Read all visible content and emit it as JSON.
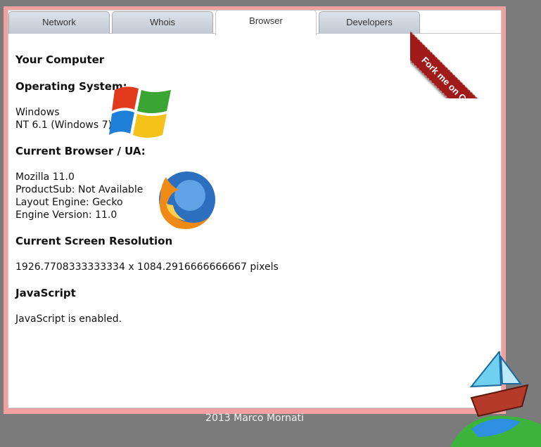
{
  "tabs": [
    {
      "label": "Network"
    },
    {
      "label": "Whois"
    },
    {
      "label": "Browser"
    },
    {
      "label": "Developers"
    }
  ],
  "active_tab": "Browser",
  "ribbon": {
    "label": "Fork me on GitHub"
  },
  "computer": {
    "heading": "Your Computer",
    "os": {
      "heading": "Operating System:",
      "line1": "Windows",
      "line2": "NT 6.1 (Windows 7)"
    },
    "browser": {
      "heading": "Current Browser / UA:",
      "line1": "Mozilla 11.0",
      "line2": "ProductSub: Not Available",
      "line3": "Layout Engine: Gecko",
      "line4": "Engine Version: 11.0"
    },
    "screen": {
      "heading": "Current Screen Resolution",
      "value": "1926.7708333333334 x 1084.2916666666667 pixels"
    },
    "javascript": {
      "heading": "JavaScript",
      "value": "JavaScript is enabled."
    }
  },
  "footer": {
    "text": "2013 Marco Mornati"
  },
  "icons": {
    "windows": "windows-logo-icon",
    "firefox": "firefox-logo-icon",
    "boat": "sailboat-icon"
  }
}
